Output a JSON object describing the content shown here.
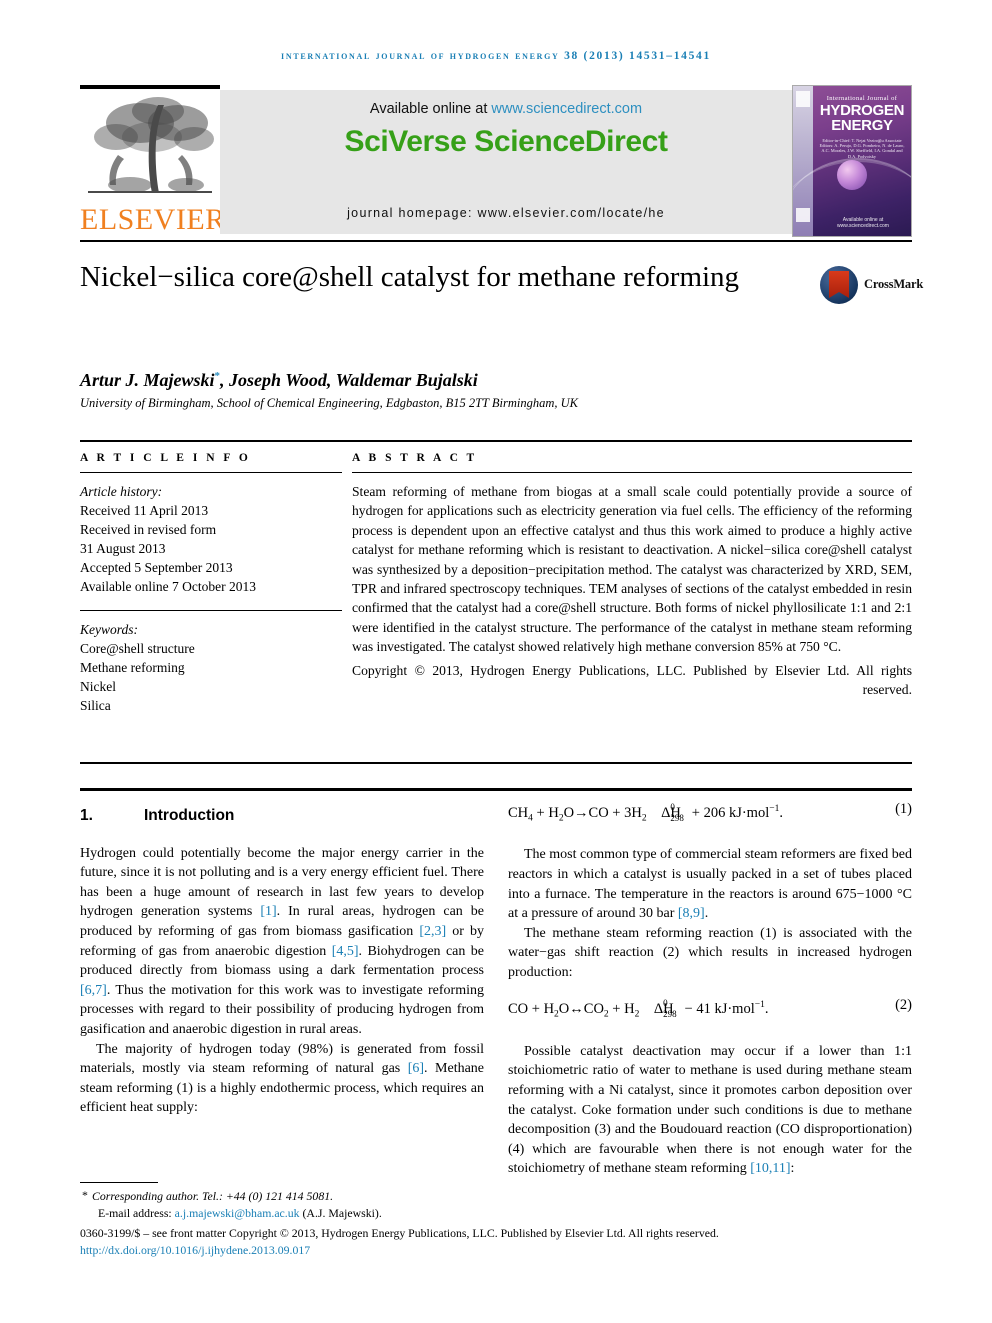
{
  "running_head": "INTERNATIONAL JOURNAL OF HYDROGEN ENERGY 38 (2013) 14531–14541",
  "masthead": {
    "elsevier_wordmark": "ELSEVIER",
    "available_prefix": "Available online at ",
    "available_link": "www.sciencedirect.com",
    "sciencedirect_title": "SciVerse ScienceDirect",
    "journal_homepage": "journal homepage: www.elsevier.com/locate/he",
    "cover": {
      "small_title": "International Journal of",
      "big_title_line1": "HYDROGEN",
      "big_title_line2": "ENERGY",
      "editors": "Editor-in-Chief: T. Nejat Veziroğlu\nAssociate Editors: A. Perujo, D.G. Pombeiro, N. de Lauro, A.C. Morales, J.W. Sheffield, I.A. Gondal and D.A. Podvoisky",
      "footer": "Available online at www.sciencedirect.com"
    }
  },
  "article": {
    "title": "Nickel−silica core@shell catalyst for methane reforming",
    "crossmark_label": "CrossMark",
    "authors": "Artur J. Majewski",
    "authors_rest": ", Joseph Wood, Waldemar Bujalski",
    "corresponding_marker": "*",
    "affiliation": "University of Birmingham, School of Chemical Engineering, Edgbaston, B15 2TT Birmingham, UK"
  },
  "info": {
    "heading": "A R T I C L E   I N F O",
    "history_label": "Article history:",
    "history": [
      "Received 11 April 2013",
      "Received in revised form",
      "31 August 2013",
      "Accepted 5 September 2013",
      "Available online 7 October 2013"
    ],
    "keywords_label": "Keywords:",
    "keywords": [
      "Core@shell structure",
      "Methane reforming",
      "Nickel",
      "Silica"
    ]
  },
  "abstract": {
    "heading": "A B S T R A C T",
    "text": "Steam reforming of methane from biogas at a small scale could potentially provide a source of hydrogen for applications such as electricity generation via fuel cells. The efficiency of the reforming process is dependent upon an effective catalyst and thus this work aimed to produce a highly active catalyst for methane reforming which is resistant to deactivation. A nickel−silica core@shell catalyst was synthesized by a deposition−precipitation method. The catalyst was characterized by XRD, SEM, TPR and infrared spectroscopy techniques. TEM analyses of sections of the catalyst embedded in resin confirmed that the catalyst had a core@shell structure. Both forms of nickel phyllosilicate 1:1 and 2:1 were identified in the catalyst structure. The performance of the catalyst in methane steam reforming was investigated. The catalyst showed relatively high methane conversion 85% at 750 °C.",
    "copyright": "Copyright © 2013, Hydrogen Energy Publications, LLC. Published by Elsevier Ltd. All rights reserved."
  },
  "body": {
    "section_number": "1.",
    "section_title": "Introduction",
    "left_p1": "Hydrogen could potentially become the major energy carrier in the future, since it is not polluting and is a very energy efficient fuel. There has been a huge amount of research in last few years to develop hydrogen generation systems [1]. In rural areas, hydrogen can be produced by reforming of gas from biomass gasification [2,3] or by reforming of gas from anaerobic digestion [4,5]. Biohydrogen can be produced directly from biomass using a dark fermentation process [6,7]. Thus the motivation for this work was to investigate reforming processes with regard to their possibility of producing hydrogen from gasification and anaerobic digestion in rural areas.",
    "left_p2": "The majority of hydrogen today (98%) is generated from fossil materials, mostly via steam reforming of natural gas [6]. Methane steam reforming (1) is a highly endothermic process, which requires an efficient heat supply:",
    "eq1": "CH4 + H2O→CO + 3H2    ΔH°298 + 206 kJ·mol−1.",
    "eq1_number": "(1)",
    "right_p1": "The most common type of commercial steam reformers are fixed bed reactors in which a catalyst is usually packed in a set of tubes placed into a furnace. The temperature in the reactors is around 675−1000 °C at a pressure of around 30 bar [8,9].",
    "right_p2": "The methane steam reforming reaction (1) is associated with the water−gas shift reaction (2) which results in increased hydrogen production:",
    "eq2": "CO + H2O↔CO2 + H2    ΔH°298 − 41 kJ·mol−1.",
    "eq2_number": "(2)",
    "right_p3": "Possible catalyst deactivation may occur if a lower than 1:1 stoichiometric ratio of water to methane is used during methane steam reforming with a Ni catalyst, since it promotes carbon deposition over the catalyst. Coke formation under such conditions is due to methane decomposition (3) and the Boudouard reaction (CO disproportionation) (4) which are favourable when there is not enough water for the stoichiometry of methane steam reforming [10,11]:"
  },
  "footnotes": {
    "corresponding": "Corresponding author. Tel.: +44 (0) 121 414 5081.",
    "email_label": "E-mail address: ",
    "email": "a.j.majewski@bham.ac.uk",
    "email_suffix": " (A.J. Majewski).",
    "issn": "0360-3199/$ – see front matter Copyright © 2013, Hydrogen Energy Publications, LLC. Published by Elsevier Ltd. All rights reserved.",
    "doi": "http://dx.doi.org/10.1016/j.ijhydene.2013.09.017"
  },
  "colors": {
    "link": "#1a7fb5",
    "sciencedirect_green": "#36a018",
    "elsevier_orange": "#f08020",
    "banner_grey": "#e6e6e6"
  }
}
